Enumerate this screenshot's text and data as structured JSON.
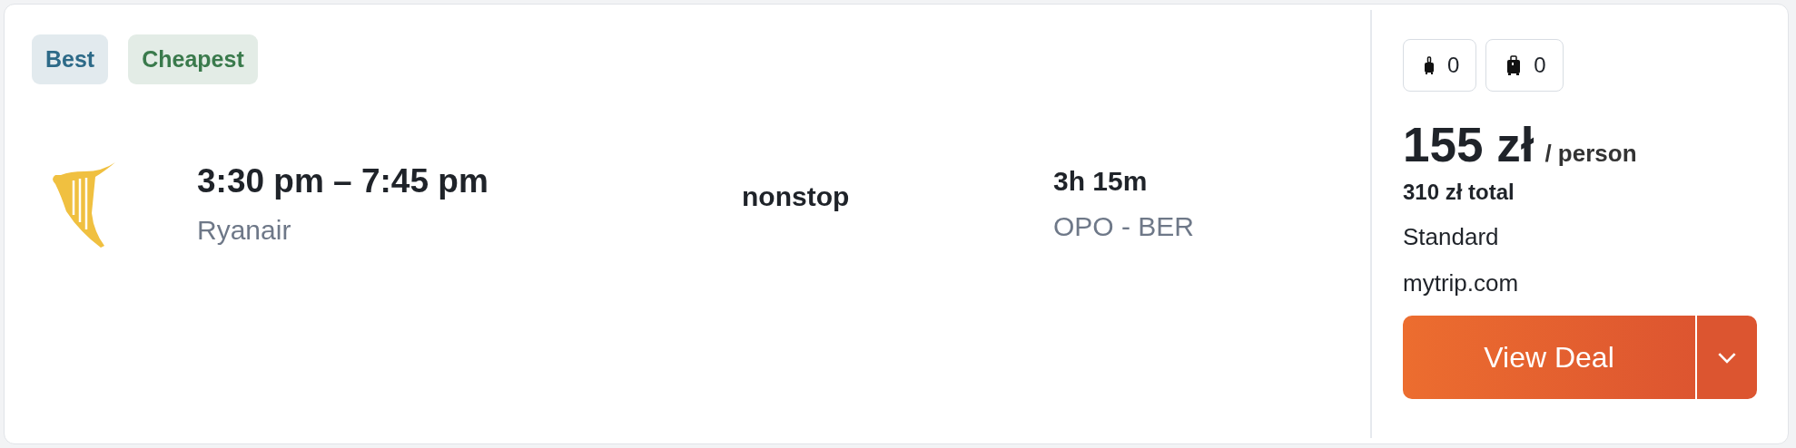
{
  "badges": [
    {
      "label": "Best",
      "color": "#2d6a88"
    },
    {
      "label": "Cheapest",
      "color": "#3a7a4c"
    }
  ],
  "flight": {
    "times": "3:30 pm – 7:45 pm",
    "airline": "Ryanair",
    "stops": "nonstop",
    "duration": "3h 15m",
    "route": "OPO - BER"
  },
  "bags": [
    {
      "kind": "carry-on",
      "count": "0"
    },
    {
      "kind": "checked",
      "count": "0"
    }
  ],
  "price": {
    "amount": "155 zł",
    "unit": "/ person",
    "total": "310 zł total",
    "fare": "Standard",
    "provider": "mytrip.com"
  },
  "button": {
    "label": "View Deal"
  }
}
